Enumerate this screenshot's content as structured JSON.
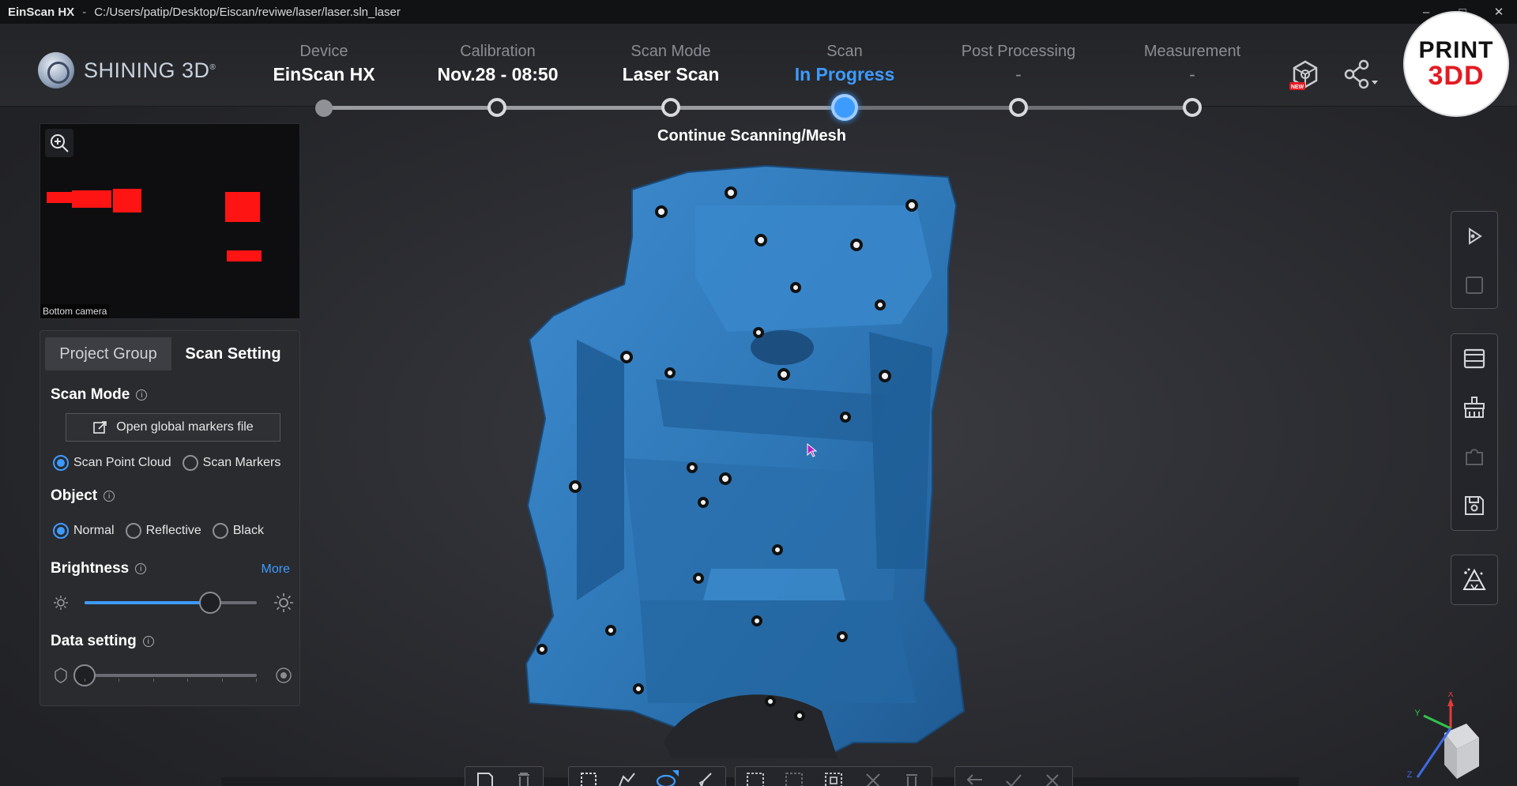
{
  "window": {
    "app_name": "EinScan HX",
    "separator": "-",
    "file_path": "C:/Users/patip/Desktop/Eiscan/reviwe/laser/laser.sln_laser",
    "minimize": "–",
    "maximize": "□",
    "close": "✕"
  },
  "brand": {
    "logo_text": "SHINING 3D",
    "reg_mark": "®",
    "badge_line1": "PRINT",
    "badge_line2": "3DD"
  },
  "steps": [
    {
      "label": "Device",
      "value": "EinScan HX",
      "state": "done"
    },
    {
      "label": "Calibration",
      "value": "Nov.28 - 08:50",
      "state": "done"
    },
    {
      "label": "Scan Mode",
      "value": "Laser Scan",
      "state": "done"
    },
    {
      "label": "Scan",
      "value": "In Progress",
      "state": "active"
    },
    {
      "label": "Post Processing",
      "value": "-",
      "state": "pending"
    },
    {
      "label": "Measurement",
      "value": "-",
      "state": "pending"
    }
  ],
  "status_message": "Continue Scanning/Mesh",
  "camera": {
    "caption": "Bottom camera"
  },
  "panel": {
    "tabs": [
      {
        "label": "Project Group",
        "active": false
      },
      {
        "label": "Scan Setting",
        "active": true
      }
    ],
    "scan_mode": {
      "title": "Scan Mode",
      "open_markers_button": "Open global markers file",
      "options": [
        {
          "label": "Scan Point Cloud",
          "selected": true
        },
        {
          "label": "Scan Markers",
          "selected": false
        }
      ]
    },
    "object": {
      "title": "Object",
      "options": [
        {
          "label": "Normal",
          "selected": true
        },
        {
          "label": "Reflective",
          "selected": false
        },
        {
          "label": "Black",
          "selected": false
        }
      ]
    },
    "brightness": {
      "title": "Brightness",
      "more_link": "More",
      "level": 0.73
    },
    "data_setting": {
      "title": "Data setting",
      "level": 0.0
    }
  },
  "right_toolbar_icons": [
    "play-scan-icon",
    "stop-icon",
    "window-icon",
    "clean-brush-icon",
    "puzzle-icon",
    "save-icon",
    "mesh-icon"
  ],
  "bottom_toolbar_icons": [
    "save-project-icon",
    "delete-icon",
    "rect-select-icon",
    "lasso-select-icon",
    "brush-select-icon",
    "select-all-icon",
    "invert-select-icon",
    "deselect-icon",
    "cut-icon",
    "undo-icon",
    "apply-icon",
    "cancel-icon"
  ],
  "colors": {
    "accent": "#3d9bff",
    "model": "#2f78b8",
    "brand_red": "#e31b23"
  },
  "axis_labels": {
    "x": "X",
    "y": "Y",
    "z": "Z"
  }
}
